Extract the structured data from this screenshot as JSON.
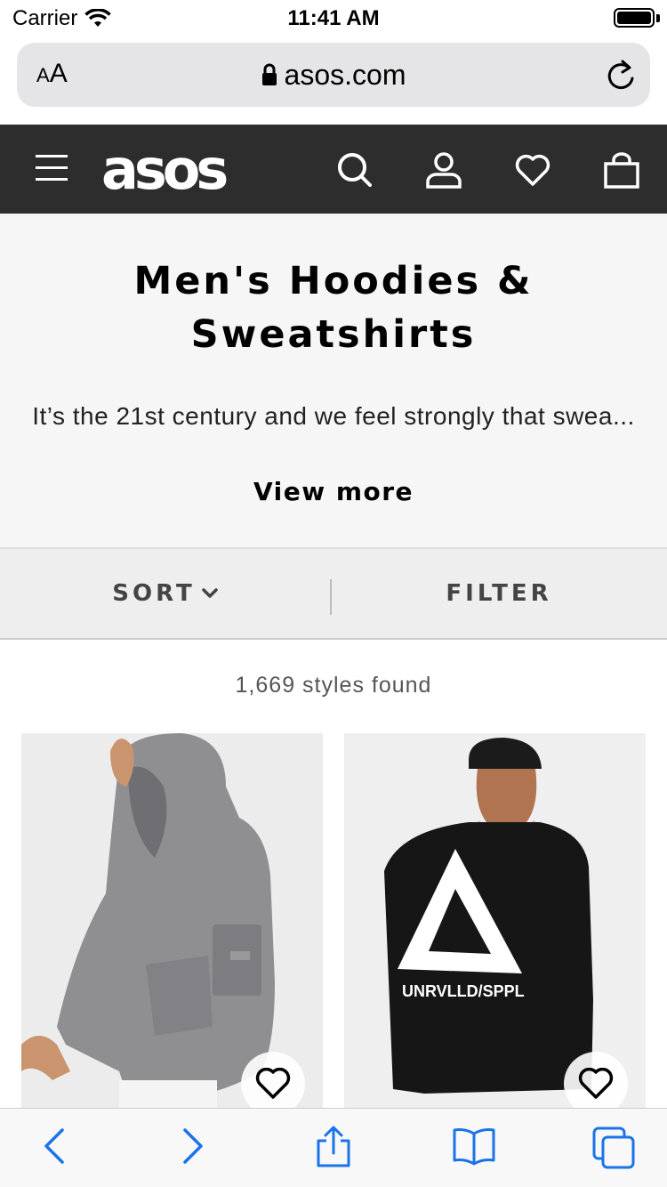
{
  "status_bar": {
    "carrier": "Carrier",
    "time": "11:41 AM"
  },
  "browser": {
    "text_size_label_small": "A",
    "text_size_label_large": "A",
    "url": "asos.com"
  },
  "site": {
    "logo": "asos",
    "header_icons": [
      "menu-icon",
      "search-icon",
      "account-icon",
      "heart-icon",
      "bag-icon"
    ]
  },
  "category": {
    "title_line1": "Men's Hoodies &",
    "title_line2": "Sweatshirts",
    "description": "It’s the 21st century and we feel strongly that swea...",
    "view_more": "View more"
  },
  "controls": {
    "sort_label": "SORT",
    "filter_label": "FILTER"
  },
  "results": {
    "count_text": "1,669 styles found"
  },
  "products": [
    {
      "image": "grey hoodie",
      "save_icon": "heart-outline-icon"
    },
    {
      "image": "black sweatshirt with triangle print",
      "print_text": "UNRVLLD/SPPL",
      "save_icon": "heart-outline-icon"
    }
  ],
  "toolbar": {
    "icons": [
      "back-icon",
      "forward-icon",
      "share-icon",
      "bookmarks-icon",
      "tabs-icon"
    ],
    "accent_color": "#1a73e8"
  },
  "colors": {
    "header_bg": "#2d2d2d",
    "banner_bg": "#f6f6f6",
    "sort_bar_bg": "#eeeeee"
  }
}
